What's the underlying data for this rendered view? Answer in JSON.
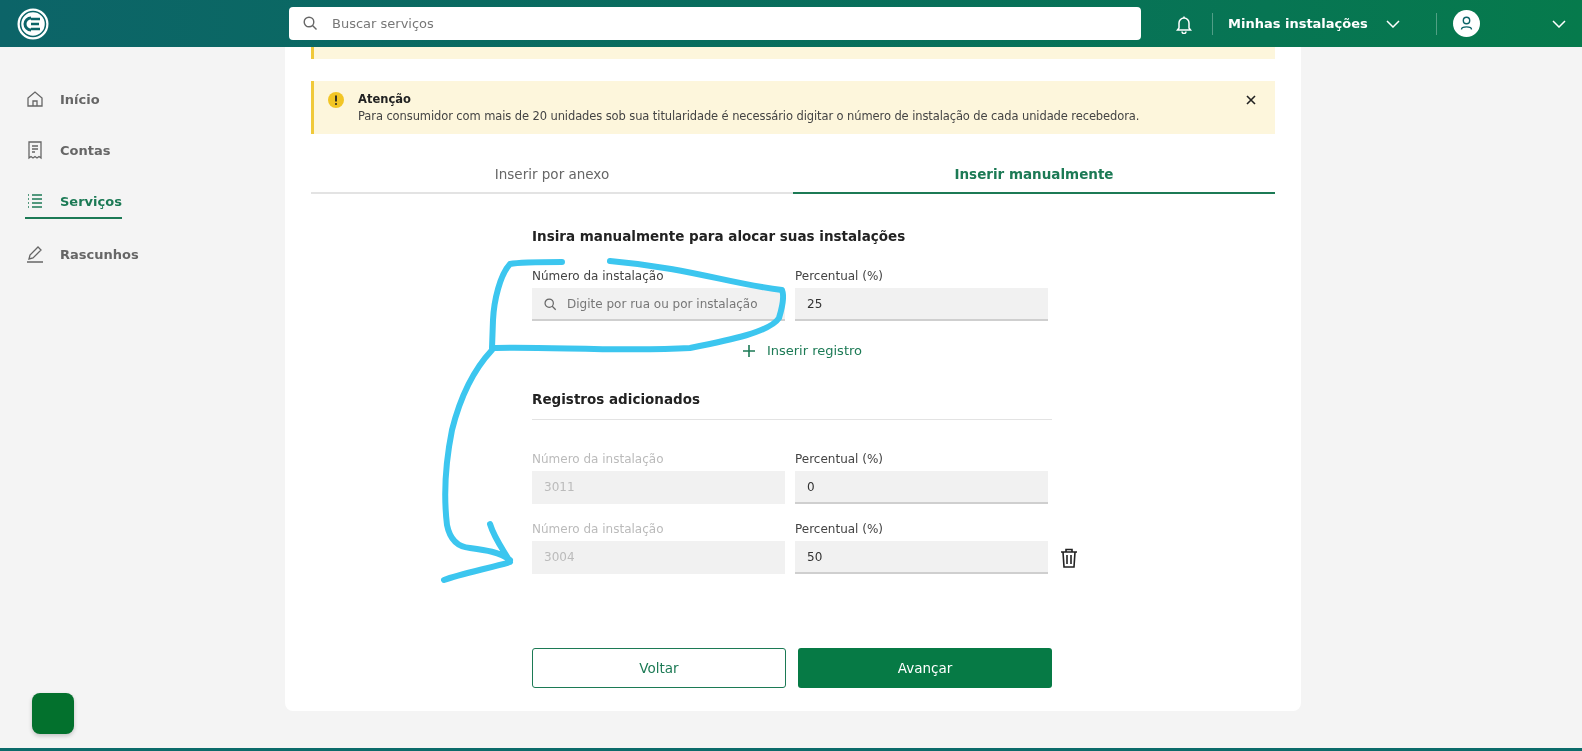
{
  "header": {
    "search": {
      "placeholder": "Buscar serviços"
    },
    "installations_menu": {
      "label": "Minhas instalações"
    }
  },
  "sidebar": {
    "items": [
      {
        "label": "Início",
        "selected": false
      },
      {
        "label": "Contas",
        "selected": false
      },
      {
        "label": "Serviços",
        "selected": true
      },
      {
        "label": "Rascunhos",
        "selected": false
      }
    ]
  },
  "alert": {
    "title": "Atenção",
    "message": "Para consumidor com mais de 20 unidades sob sua titularidade é necessário digitar o número de instalação de cada unidade recebedora."
  },
  "tabs": [
    {
      "label": "Inserir por anexo",
      "selected": false
    },
    {
      "label": "Inserir manualmente",
      "selected": true
    }
  ],
  "form": {
    "heading": "Insira manualmente para alocar suas instalações",
    "installation_field": {
      "label": "Número da instalação",
      "placeholder": "Digite por rua ou por instalação"
    },
    "percent_field": {
      "label": "Percentual (%)",
      "value": "25"
    },
    "add_link": "Inserir registro"
  },
  "records": {
    "heading": "Registros adicionados",
    "rows": [
      {
        "installation_label": "Número da instalação",
        "installation": "3011",
        "installation_disabled": true,
        "percent_label": "Percentual (%)",
        "percent": "0",
        "deletable": false
      },
      {
        "installation_label": "Número da instalação",
        "installation": "3004",
        "installation_disabled": true,
        "percent_label": "Percentual (%)",
        "percent": "50",
        "deletable": true
      }
    ]
  },
  "buttons": {
    "back": "Voltar",
    "next": "Avançar"
  }
}
